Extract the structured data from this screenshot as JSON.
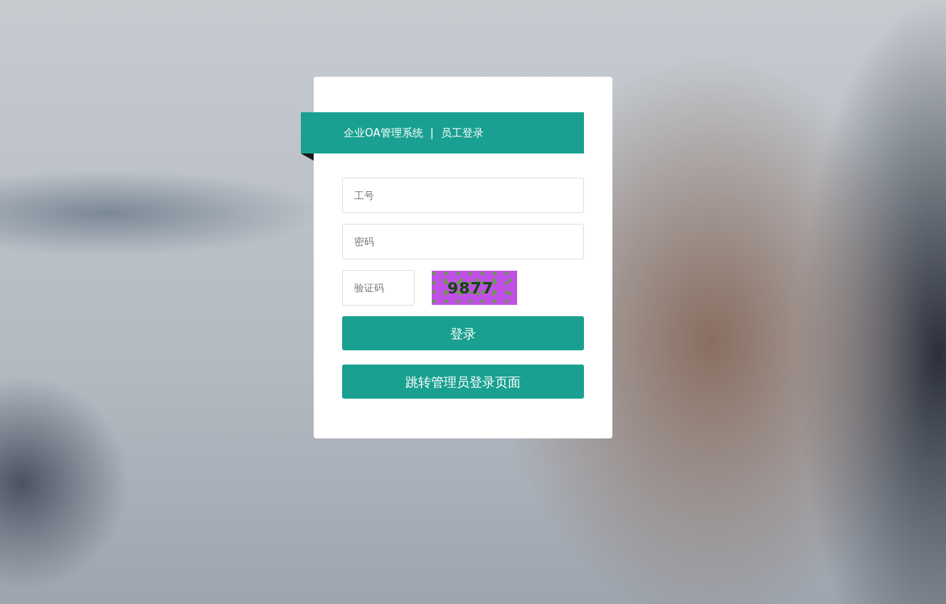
{
  "header": {
    "system_name": "企业OA管理系统",
    "separator": "|",
    "page_title": "员工登录"
  },
  "fields": [
    {
      "placeholder": "工号"
    },
    {
      "placeholder": "密码"
    }
  ],
  "captcha": {
    "placeholder": "验证码",
    "code": "9877"
  },
  "buttons": [
    {
      "label": "登录",
      "kind": "submit"
    },
    {
      "label": "跳转管理员登录页面",
      "kind": "link"
    }
  ]
}
